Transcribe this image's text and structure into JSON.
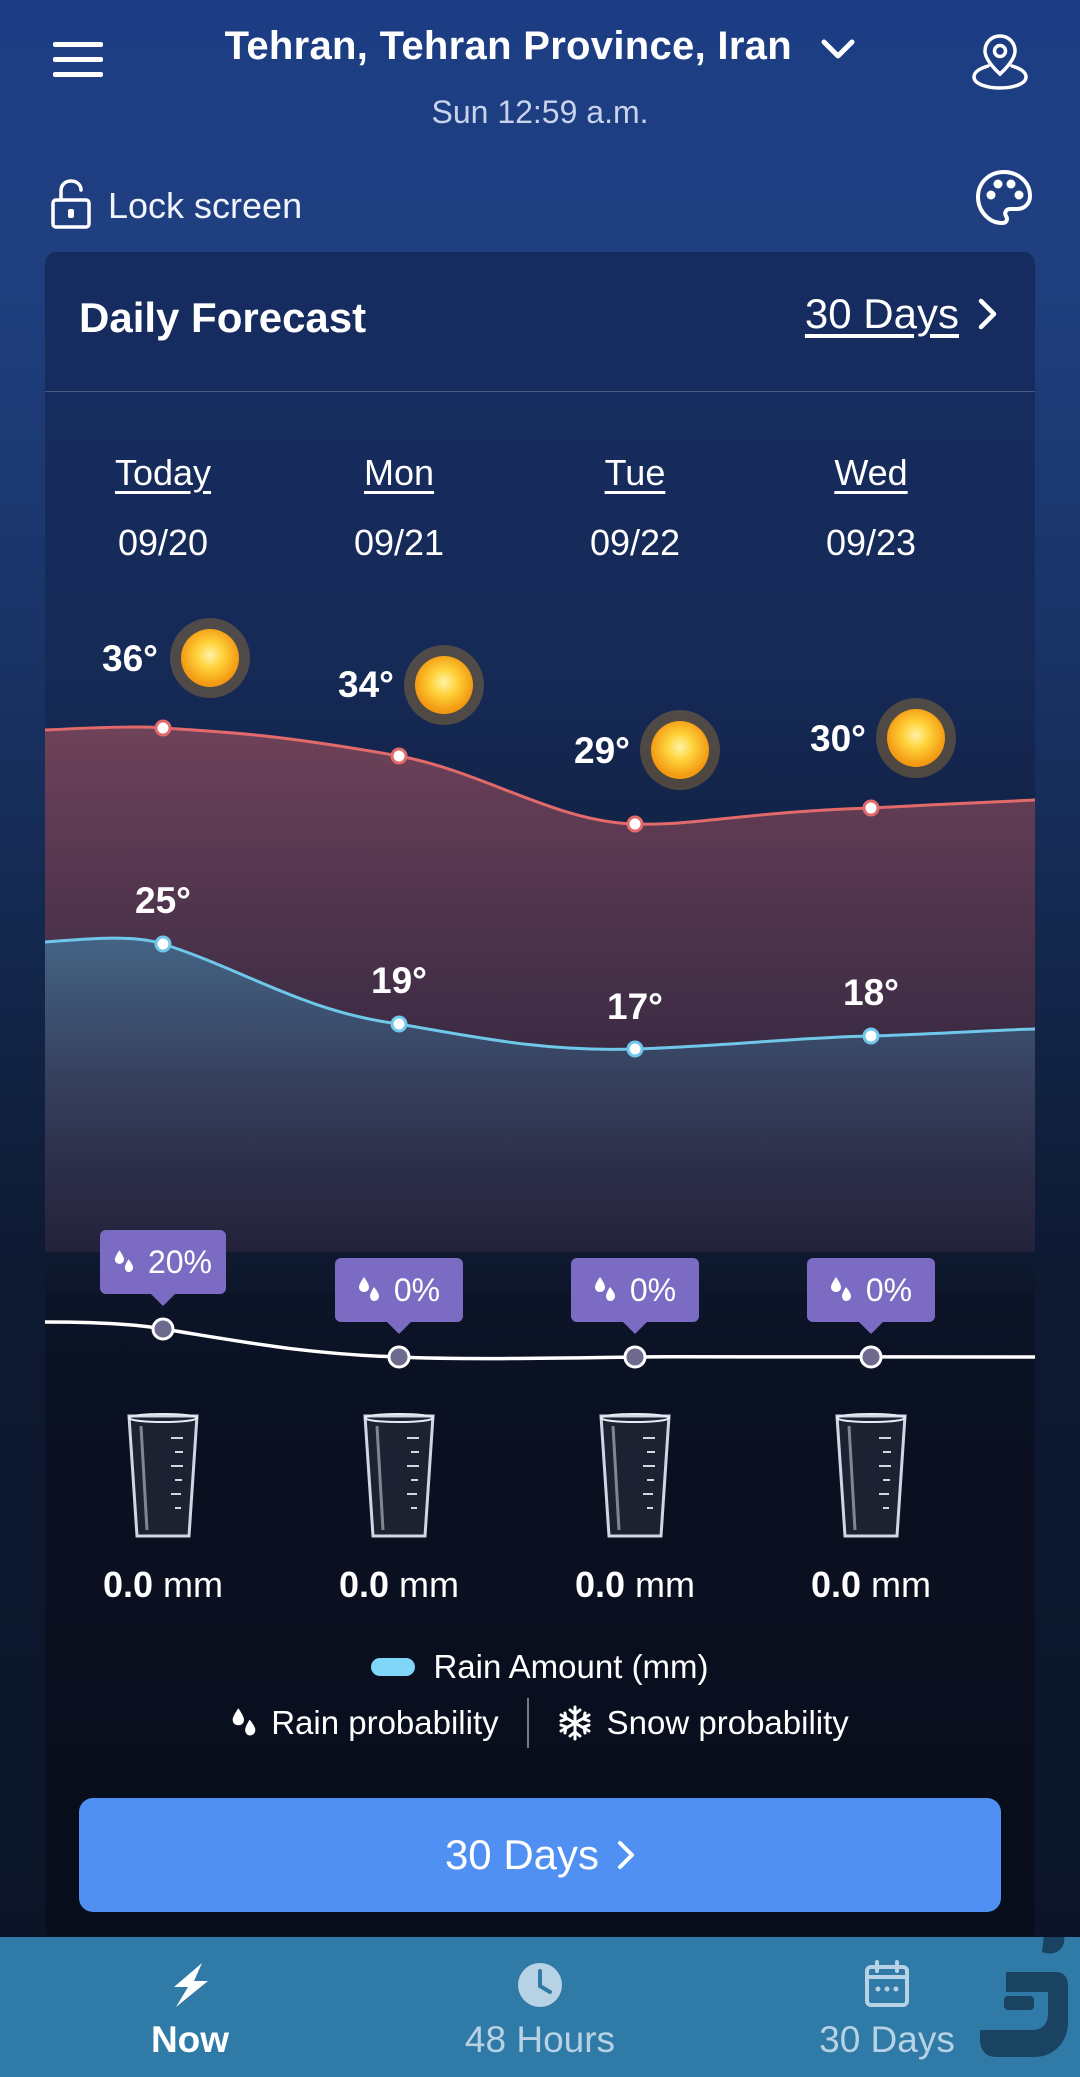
{
  "header": {
    "location": "Tehran, Tehran Province, Iran",
    "datetime": "Sun 12:59 a.m.",
    "lock_label": "Lock screen"
  },
  "card": {
    "title": "Daily Forecast",
    "link_label": "30 Days"
  },
  "days": [
    {
      "name": "Today",
      "date": "09/20",
      "high": "36°",
      "low": "25°",
      "prob": "20%",
      "amount": "0.0",
      "unit": "mm",
      "icon": "sun-icon"
    },
    {
      "name": "Mon",
      "date": "09/21",
      "high": "34°",
      "low": "19°",
      "prob": "0%",
      "amount": "0.0",
      "unit": "mm",
      "icon": "sun-icon"
    },
    {
      "name": "Tue",
      "date": "09/22",
      "high": "29°",
      "low": "17°",
      "prob": "0%",
      "amount": "0.0",
      "unit": "mm",
      "icon": "sun-icon"
    },
    {
      "name": "Wed",
      "date": "09/23",
      "high": "30°",
      "low": "18°",
      "prob": "0%",
      "amount": "0.0",
      "unit": "mm",
      "icon": "sun-icon"
    }
  ],
  "legend": {
    "rain_amount": "Rain Amount (mm)",
    "rain_probability": "Rain probability",
    "snow_probability": "Snow probability"
  },
  "button": {
    "label": "30 Days"
  },
  "nav": [
    {
      "label": "Now",
      "icon": "lightning-icon",
      "active": true
    },
    {
      "label": "48 Hours",
      "icon": "clock-icon",
      "active": false
    },
    {
      "label": "30 Days",
      "icon": "calendar-icon",
      "active": false
    }
  ],
  "colors": {
    "high_line": "#e26a6a",
    "low_line": "#6fc7ea",
    "probability_badge": "#7c6bc2",
    "button": "#4f90f2",
    "bottom_nav": "#2f7aa6"
  }
}
